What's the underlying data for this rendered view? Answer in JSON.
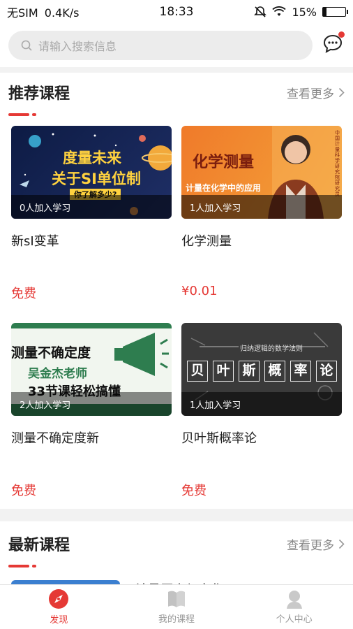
{
  "status": {
    "carrier": "无SIM",
    "speed": "0.4K/s",
    "time": "18:33",
    "battery": "15%",
    "battery_level": 0.15
  },
  "search": {
    "placeholder": "请输入搜索信息"
  },
  "recommended": {
    "title": "推荐课程",
    "more": "查看更多",
    "courses": [
      {
        "title": "新sI变革",
        "learners": "0人加入学习",
        "price": "免费",
        "poster": {
          "line1": "度量未来",
          "line2": "关于SI单位制",
          "line3": "你了解多少?"
        }
      },
      {
        "title": "化学测量",
        "learners": "1人加入学习",
        "price": "¥0.01",
        "poster": {
          "line1": "化学测量",
          "line2": "计量在化学中的应用",
          "side1": "中国计量科学研究院 研究员",
          "side2": "董学胜博士"
        }
      },
      {
        "title": "测量不确定度新",
        "learners": "2人加入学习",
        "price": "免费",
        "poster": {
          "line1": "测量不确定度",
          "line2": "吴金杰老师",
          "line3": "33节课轻松搞懂"
        }
      },
      {
        "title": "贝叶斯概率论",
        "learners": "1人加入学习",
        "price": "免费",
        "poster": {
          "line1": "归纳逻辑的数学法则",
          "chars": [
            "贝",
            "叶",
            "斯",
            "概",
            "率",
            "论"
          ]
        }
      }
    ]
  },
  "latest": {
    "title": "最新课程",
    "more": "查看更多",
    "partial_title": "计量历史与文化"
  },
  "tabs": [
    {
      "label": "发现",
      "icon": "compass-icon"
    },
    {
      "label": "我的课程",
      "icon": "book-icon"
    },
    {
      "label": "个人中心",
      "icon": "person-icon"
    }
  ],
  "colors": {
    "accent": "#e53935"
  }
}
